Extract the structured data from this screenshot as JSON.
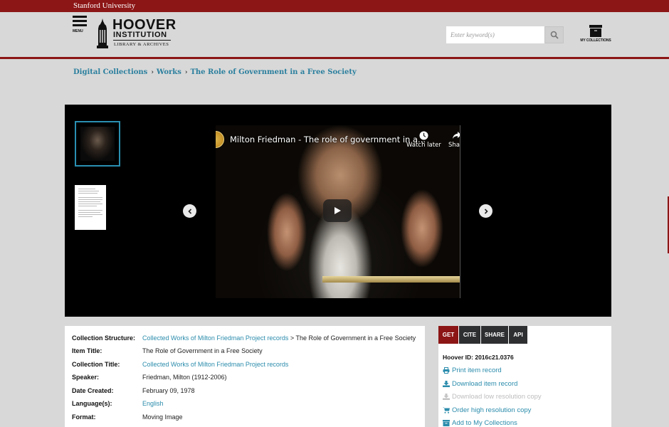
{
  "topbar": {
    "university": "Stanford University"
  },
  "header": {
    "menu_label": "MENU",
    "logo": {
      "line1": "HOOVER",
      "line2": "INSTITUTION",
      "line3": "LIBRARY & ARCHIVES"
    },
    "search": {
      "placeholder": "Enter keyword(s)",
      "value": "",
      "button_icon": "search-icon"
    },
    "my_collections_label": "MY COLLECTIONS"
  },
  "breadcrumb": [
    {
      "label": "Digital Collections"
    },
    {
      "label": "Works"
    },
    {
      "label": "The Role of Government in a Free Society"
    }
  ],
  "breadcrumb_separator": "›",
  "viewer": {
    "thumbnails": [
      {
        "type": "video",
        "selected": true
      },
      {
        "type": "document",
        "selected": false
      }
    ],
    "prev_icon": "chevron-left-icon",
    "next_icon": "chevron-right-icon",
    "video": {
      "title": "Milton Friedman - The role of government in a...",
      "watch_later_label": "Watch later",
      "share_label": "Share"
    }
  },
  "details": {
    "rows": [
      {
        "key": "Collection Structure:",
        "link": "Collected Works of Milton Friedman Project records",
        "suffix": " > The Role of Government in a Free Society"
      },
      {
        "key": "Item Title:",
        "value": "The Role of Government in a Free Society"
      },
      {
        "key": "Collection Title:",
        "link": "Collected Works of Milton Friedman Project records"
      },
      {
        "key": "Speaker:",
        "value": "Friedman, Milton (1912-2006)"
      },
      {
        "key": "Date Created:",
        "value": "February 09, 1978"
      },
      {
        "key": "Language(s):",
        "link": "English"
      },
      {
        "key": "Format:",
        "value": "Moving Image"
      }
    ]
  },
  "sidepanel": {
    "tabs": [
      {
        "label": "GET",
        "active": true
      },
      {
        "label": "CITE",
        "active": false
      },
      {
        "label": "SHARE",
        "active": false
      },
      {
        "label": "API",
        "active": false
      }
    ],
    "hoover_id": "Hoover ID: 2016c21.0376",
    "actions": [
      {
        "label": "Print item record",
        "icon": "print-icon",
        "enabled": true
      },
      {
        "label": "Download item record",
        "icon": "download-icon",
        "enabled": true
      },
      {
        "label": "Download low resolution copy",
        "icon": "download-icon",
        "enabled": false
      },
      {
        "label": "Order high resolution copy",
        "icon": "cart-icon",
        "enabled": true
      },
      {
        "label": "Add to My Collections",
        "icon": "archive-box-icon",
        "enabled": true
      }
    ]
  },
  "colors": {
    "brand_red": "#8c1515",
    "link_teal": "#2b8cac",
    "breadcrumb_teal": "#2b7f9e",
    "tab_dark": "#2e2f31",
    "thumb_border": "#2a8fb1",
    "page_bg": "#d8d8d8"
  }
}
